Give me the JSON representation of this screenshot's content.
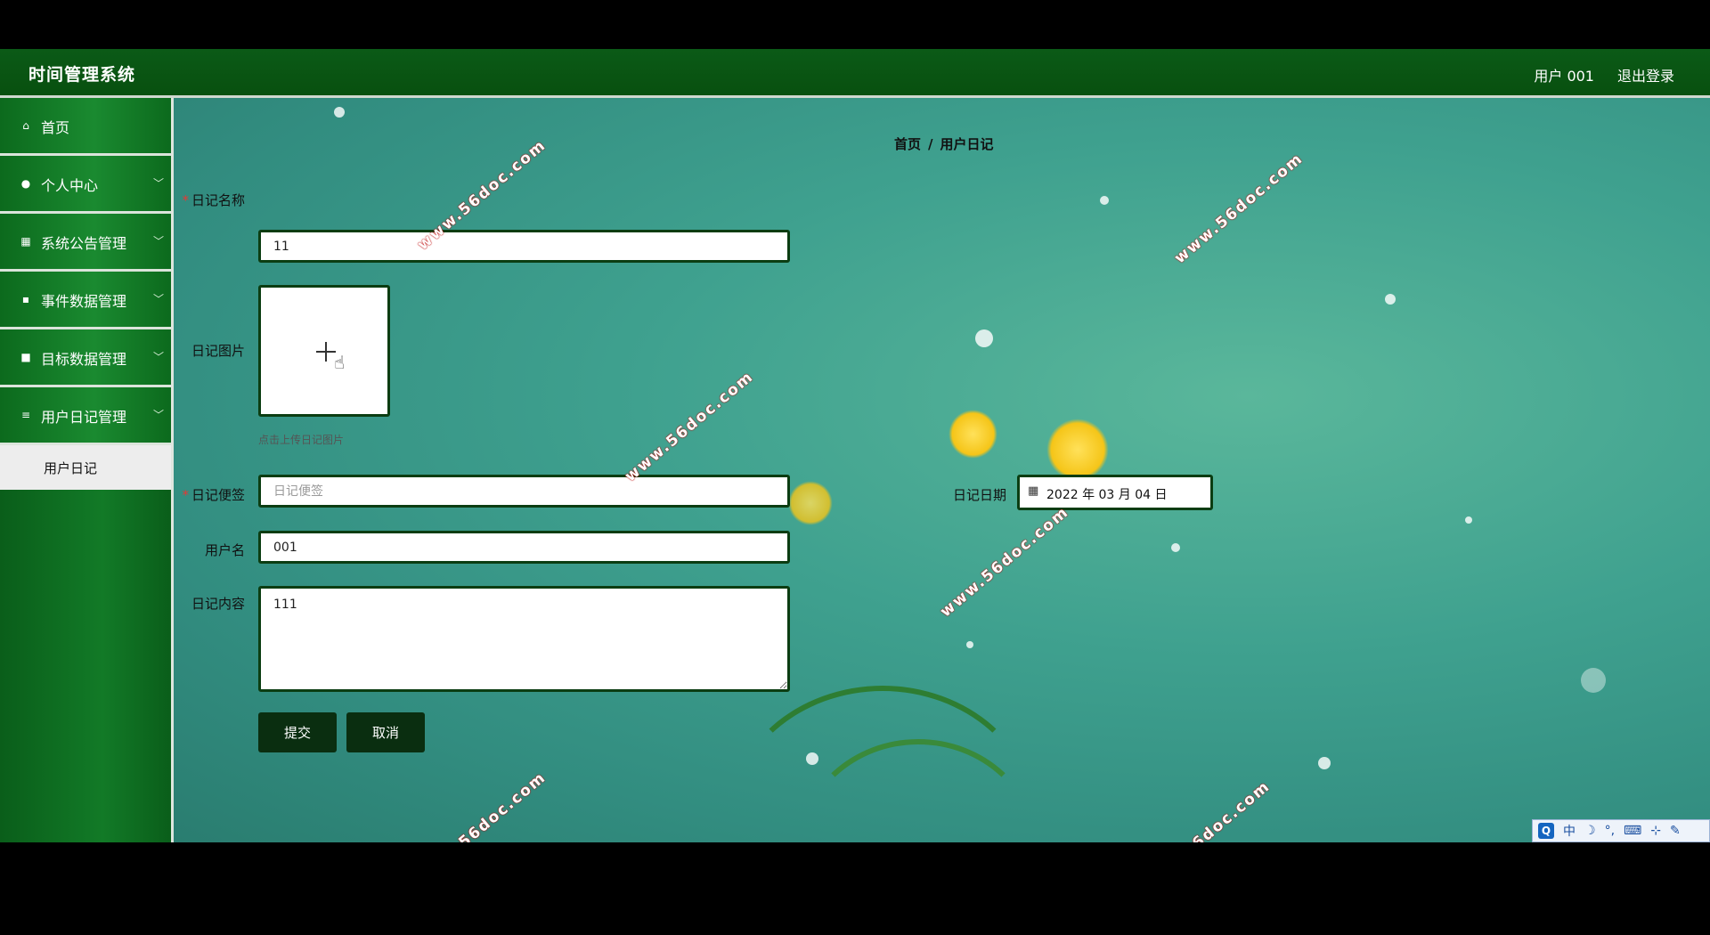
{
  "header": {
    "title": "时间管理系统",
    "user": "用户 001",
    "logout": "退出登录"
  },
  "sidebar": {
    "items": [
      {
        "label": "首页",
        "icon": "home-icon",
        "glyph": "⌂"
      },
      {
        "label": "个人中心",
        "icon": "person-icon",
        "glyph": "●"
      },
      {
        "label": "系统公告管理",
        "icon": "grid-icon",
        "glyph": "▦"
      },
      {
        "label": "事件数据管理",
        "icon": "apps-icon",
        "glyph": "▪"
      },
      {
        "label": "目标数据管理",
        "icon": "database-icon",
        "glyph": "■"
      },
      {
        "label": "用户日记管理",
        "icon": "list-icon",
        "glyph": "≡"
      }
    ],
    "submenu": "用户日记",
    "chevron": "﹀"
  },
  "breadcrumb": {
    "home": "首页",
    "separator": "/",
    "current": "用户日记"
  },
  "form": {
    "name_label": "日记名称",
    "name_value": "11",
    "image_label": "日记图片",
    "image_hint": "点击上传日记图片",
    "note_label": "日记便签",
    "note_placeholder": "日记便签",
    "date_label": "日记日期",
    "date_value": "2022 年 03 月 04 日",
    "username_label": "用户名",
    "username_value": "001",
    "content_label": "日记内容",
    "content_value": "111",
    "required_mark": "*",
    "submit": "提交",
    "cancel": "取消"
  },
  "watermark": "www.56doc.com",
  "ime": {
    "q": "Q",
    "lang": "中",
    "moon": "☽",
    "punct": "°,",
    "keyboard": "⌨",
    "extra": "⊹",
    "tool": "✎"
  }
}
